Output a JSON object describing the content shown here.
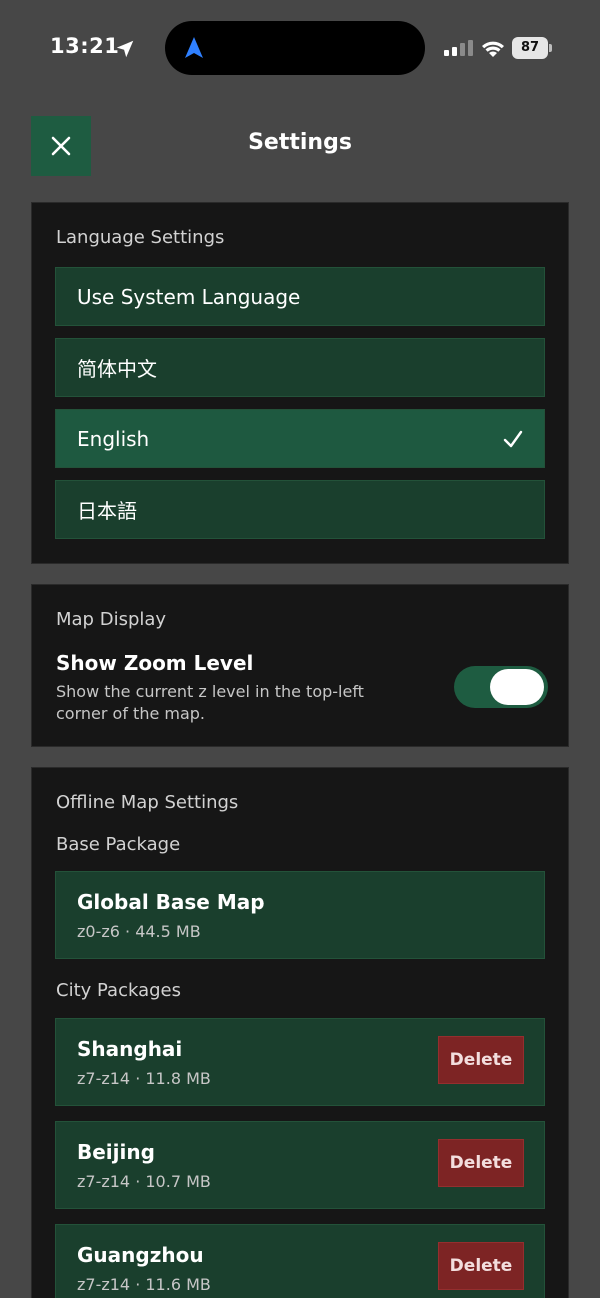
{
  "status_bar": {
    "time": "13:21",
    "battery": "87",
    "icons": [
      "location-arrow-icon",
      "navigation-arrow-icon",
      "signal-icon",
      "wifi-icon",
      "battery-icon"
    ]
  },
  "header": {
    "title": "Settings",
    "close_icon": "close-icon"
  },
  "language_settings": {
    "label": "Language Settings",
    "options": [
      {
        "label": "Use System Language",
        "selected": false
      },
      {
        "label": "简体中文",
        "selected": false
      },
      {
        "label": "English",
        "selected": true
      },
      {
        "label": "日本語",
        "selected": false
      }
    ],
    "check_icon": "checkmark-icon"
  },
  "map_display": {
    "label": "Map Display",
    "show_zoom": {
      "title": "Show Zoom Level",
      "description": "Show the current z level in the top-left corner of the map.",
      "enabled": true
    }
  },
  "offline_map": {
    "label": "Offline Map Settings",
    "base_label": "Base Package",
    "base_package": {
      "name": "Global Base Map",
      "meta": "z0-z6 · 44.5 MB"
    },
    "city_label": "City Packages",
    "delete_label": "Delete",
    "cities": [
      {
        "name": "Shanghai",
        "meta": "z7-z14 · 11.8 MB"
      },
      {
        "name": "Beijing",
        "meta": "z7-z14 · 10.7 MB"
      },
      {
        "name": "Guangzhou",
        "meta": "z7-z14 · 11.6 MB"
      }
    ]
  },
  "colors": {
    "background": "#474747",
    "panel": "#161616",
    "accent_green": "#1e5c41",
    "option_green": "#1a3f2d",
    "delete_red": "#7d2424"
  }
}
